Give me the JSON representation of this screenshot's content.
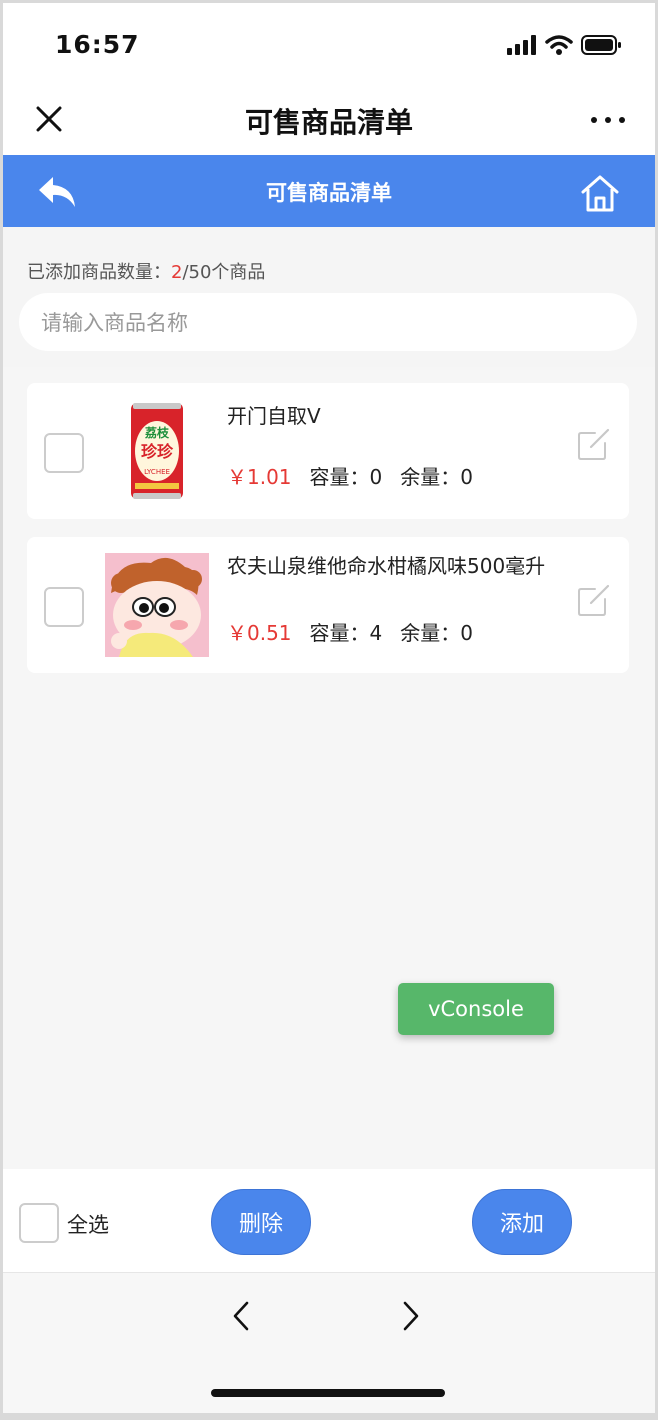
{
  "status": {
    "time": "16:57"
  },
  "wechat_nav": {
    "title": "可售商品清单"
  },
  "page_header": {
    "title": "可售商品清单"
  },
  "summary": {
    "prefix": "已添加商品数量：",
    "count": "2",
    "suffix": "/50个商品"
  },
  "search": {
    "placeholder": "请输入商品名称"
  },
  "products": [
    {
      "name": "开门自取V",
      "price": "￥1.01",
      "capacity": "容量：0",
      "remaining": "余量：0",
      "image": "lychee-can"
    },
    {
      "name": "农夫山泉维他命水柑橘风味500毫升",
      "price": "￥0.51",
      "capacity": "容量：4",
      "remaining": "余量：0",
      "image": "cartoon-avatar"
    }
  ],
  "can_label": {
    "brand_top": "荔枝",
    "brand_main": "珍珍",
    "sub": "LYCHEE"
  },
  "vconsole": {
    "label": "vConsole"
  },
  "bottom": {
    "select_all": "全选",
    "delete": "删除",
    "add": "添加"
  },
  "colors": {
    "accent": "#4a86ec",
    "price": "#e53935",
    "vconsole": "#57b76a"
  },
  "icons": [
    "close-icon",
    "more-icon",
    "back-arrow-icon",
    "home-icon",
    "edit-icon",
    "chevron-left-icon",
    "chevron-right-icon"
  ]
}
